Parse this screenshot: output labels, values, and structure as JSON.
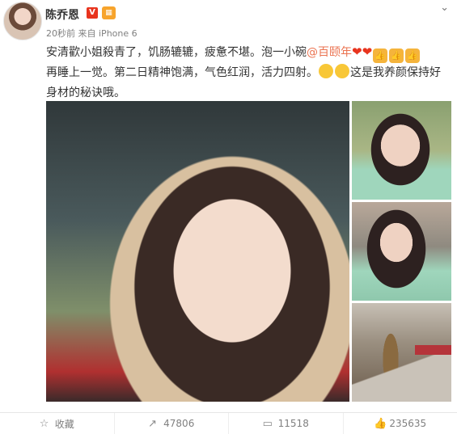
{
  "post": {
    "author": "陈乔恩",
    "vip_mark": "V",
    "time": "20秒前",
    "source_prefix": "来自",
    "source": "iPhone 6",
    "line1_a": "安清歡小姐殺青了，饥肠辘辘，疲惫不堪。泡一小碗",
    "mention": "@百颐年",
    "line2": "再睡上一觉。第二日精神饱满，气色红润，活力四射。",
    "line2_tail": "这是我养颜保持好",
    "line3": "身材的秘诀哦。"
  },
  "icons": {
    "menu": "chevron-down",
    "heart": "red-heart",
    "thumbs": "thumbs-up",
    "grin": "grinning-face",
    "victory": "victory-hand"
  },
  "footer": {
    "favorite_label": "收藏",
    "forward_count": "47806",
    "comment_count": "11518",
    "like_count": "235635"
  },
  "colors": {
    "link": "#eb7350",
    "vip": "#e8341e"
  }
}
